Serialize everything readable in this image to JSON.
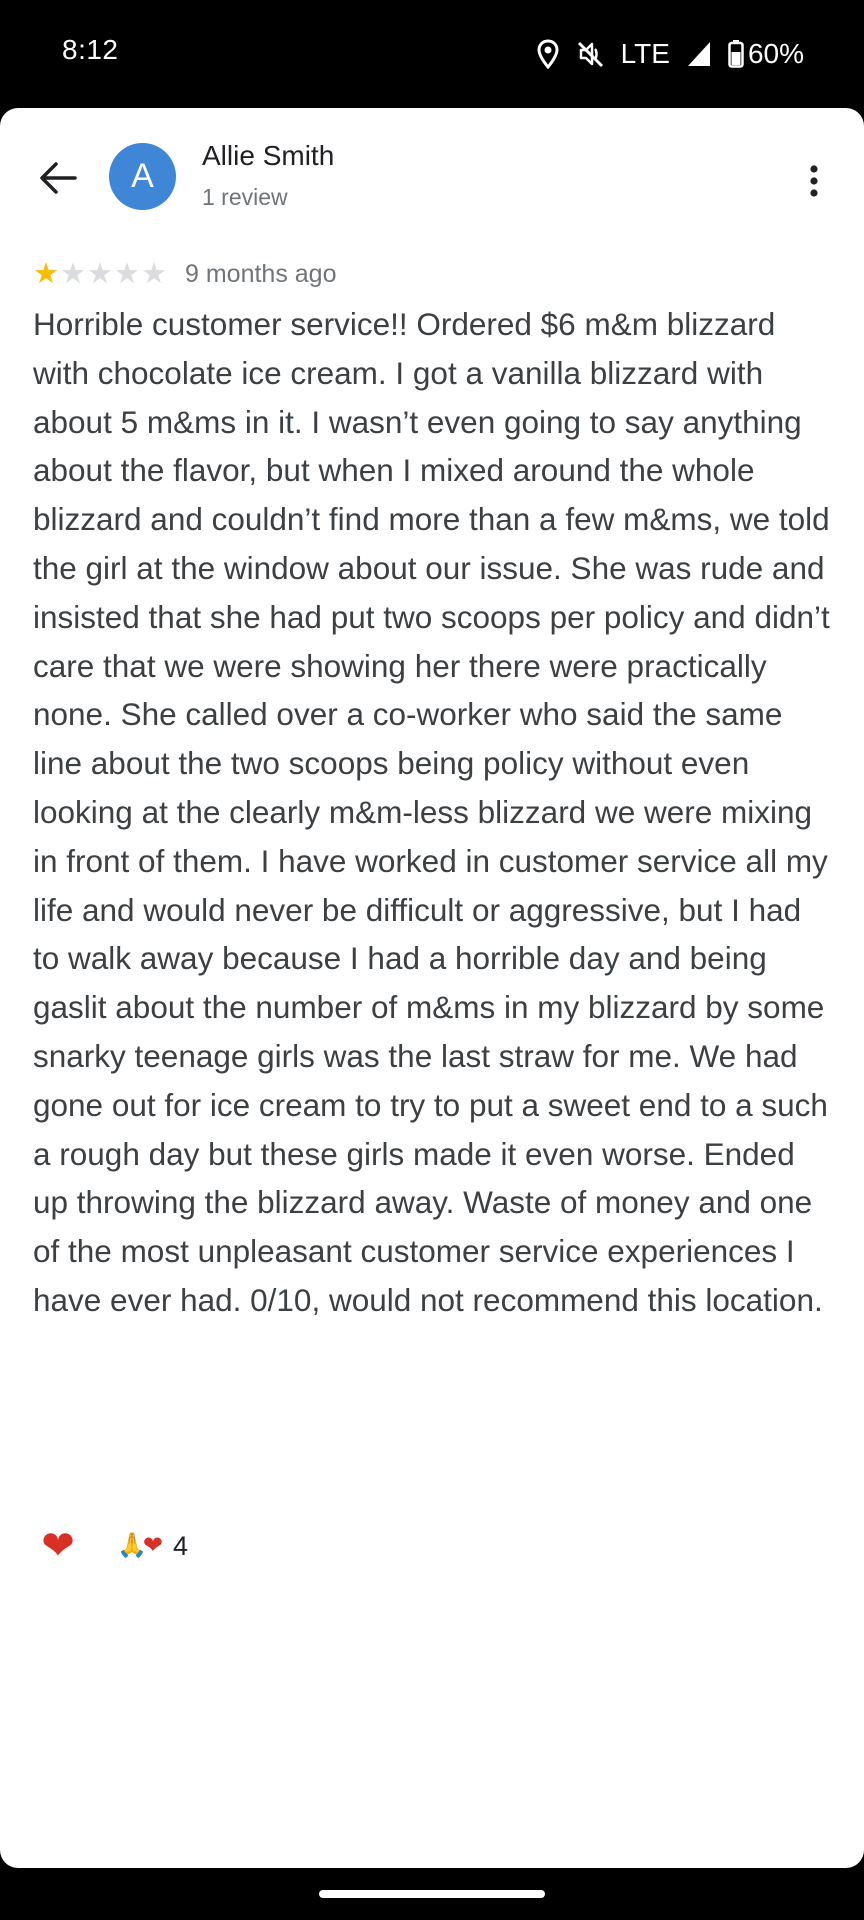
{
  "status_bar": {
    "time": "8:12",
    "network": "LTE",
    "battery": "60%",
    "icons": [
      "location-icon",
      "mute-icon",
      "signal-icon",
      "battery-icon"
    ]
  },
  "header": {
    "avatar_letter": "A",
    "avatar_color": "#3f86d6",
    "name": "Allie Smith",
    "review_count": "1 review",
    "icons": [
      "back-arrow-icon",
      "more-vert-icon"
    ]
  },
  "review": {
    "rating": 1,
    "max_rating": 5,
    "star_color": "#fbbc04",
    "date": "9 months ago",
    "text": "Horrible customer service!! Ordered $6 m&m blizzard with chocolate ice cream. I got a vanilla blizzard with about 5 m&ms in it. I wasn’t even going to say anything about the flavor, but when I mixed around the whole blizzard and couldn’t find more than a few m&ms, we told the girl at the window about our issue. She was rude and insisted that she had put two scoops per policy and didn’t care that we were showing her there were practically none. She called over a co-worker who said the same line about the two scoops being policy without even looking at the clearly m&m-less blizzard we were mixing in front of them. I have worked in customer service all my life and would never be difficult or aggressive, but I had to walk away because I had a horrible day and being gaslit about the number of m&ms in my blizzard by some snarky teenage girls was the last straw for me. We had gone out for ice cream to try to put a sweet end to a such a rough day but these girls made it even worse. Ended up throwing the blizzard away. Waste of money and one of the most unpleasant customer service experiences I have ever had. 0/10, would not recommend this location."
  },
  "reactions": {
    "react_button_icon": "heart-icon",
    "summary_icons": [
      "pray-emoji-icon",
      "heart-emoji-icon"
    ],
    "count": "4"
  }
}
